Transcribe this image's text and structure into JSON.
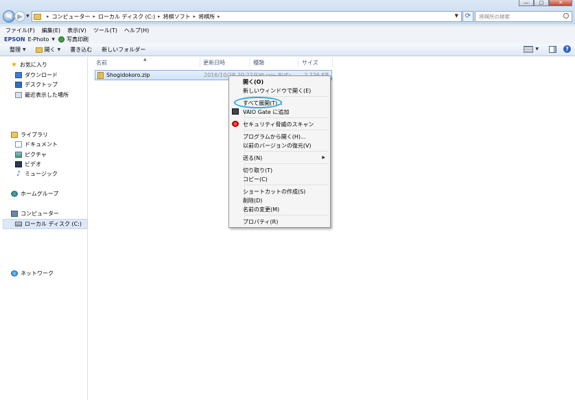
{
  "window": {
    "min_label": "—",
    "max_label": "□",
    "close_label": "✕"
  },
  "address": {
    "crumbs": [
      "コンピューター",
      "ローカル ディスク (C:)",
      "将棋ソフト",
      "将棋所"
    ],
    "separator": "▸"
  },
  "search": {
    "placeholder": "将棋所の検索"
  },
  "menubar": {
    "items": [
      "ファイル(F)",
      "編集(E)",
      "表示(V)",
      "ツール(T)",
      "ヘルプ(H)"
    ]
  },
  "epson": {
    "brand": "EPSON",
    "app": "E-Photo",
    "print_label": "写真印刷"
  },
  "toolbar": {
    "organize": "整理",
    "open": "開く",
    "burn": "書き込む",
    "new_folder": "新しいフォルダー",
    "help": "?"
  },
  "navpane": {
    "favorites": "お気に入り",
    "downloads": "ダウンロード",
    "desktop": "デスクトップ",
    "recent": "最近表示した場所",
    "libraries": "ライブラリ",
    "documents": "ドキュメント",
    "pictures": "ピクチャ",
    "videos": "ビデオ",
    "music": "ミュージック",
    "homegroup": "ホームグループ",
    "computer": "コンピューター",
    "local_disk": "ローカル ディスク (C:)",
    "network": "ネットワーク"
  },
  "columns": {
    "name": "名前",
    "date": "更新日時",
    "type": "種類",
    "size": "サイズ"
  },
  "file": {
    "name": "Shogidokoro.zip",
    "date": "2016/10/28 20:22",
    "type": "圧縮 (zip 形式)",
    "size": "2,226 KB"
  },
  "context_menu": {
    "open": "開く(O)",
    "open_new_window": "新しいウィンドウで開く(E)",
    "extract_all": "すべて展開(T)...",
    "vaio_gate": "VAIO Gate に追加",
    "security_scan": "セキュリティ脅威のスキャン",
    "open_with": "プログラムから開く(H)...",
    "restore_previous": "以前のバージョンの復元(V)",
    "send_to": "送る(N)",
    "cut": "切り取り(T)",
    "copy": "コピー(C)",
    "create_shortcut": "ショートカットの作成(S)",
    "delete": "削除(D)",
    "rename": "名前の変更(M)",
    "properties": "プロパティ(R)"
  },
  "colors": {
    "accent_ring": "#26a8e0",
    "selection": "#cfe2f7",
    "chrome": "#c6d9ee"
  }
}
